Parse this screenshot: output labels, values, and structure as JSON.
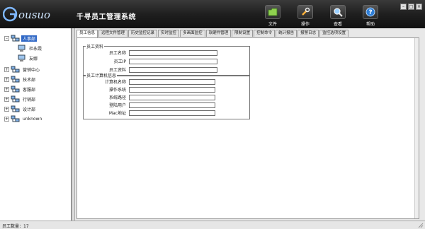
{
  "app": {
    "logo_text": "Gousuo",
    "title": "千寻员工管理系统"
  },
  "toolbar": [
    {
      "label": "文件",
      "icon": "folder-icon"
    },
    {
      "label": "操作",
      "icon": "wrench-icon"
    },
    {
      "label": "查看",
      "icon": "magnifier-icon"
    },
    {
      "label": "帮助",
      "icon": "help-icon"
    }
  ],
  "window_controls": [
    "minimize",
    "maximize",
    "close"
  ],
  "sidebar": {
    "root": {
      "label": "人事部",
      "children": [
        {
          "label": "杜永霞"
        },
        {
          "label": "友娜"
        }
      ]
    },
    "groups": [
      {
        "label": "营销中心"
      },
      {
        "label": "技术部"
      },
      {
        "label": "客服部"
      },
      {
        "label": "行销部"
      },
      {
        "label": "设计部"
      },
      {
        "label": "unknown"
      }
    ]
  },
  "tabs": [
    "员工信息",
    "远程文件管理",
    "历史监控记录",
    "实时监控",
    "多画面监控",
    "软硬件管理",
    "限制设置",
    "控制命令",
    "统计报告",
    "报警日志",
    "监控选项设置"
  ],
  "employee_info": {
    "legend": "员工资料",
    "fields": [
      {
        "label": "员工名称",
        "value": ""
      },
      {
        "label": "员工IP",
        "value": ""
      },
      {
        "label": "员工资料",
        "value": ""
      }
    ]
  },
  "computer_info": {
    "legend": "员工计算机信息",
    "fields": [
      {
        "label": "计算机名称",
        "value": ""
      },
      {
        "label": "操作系统",
        "value": ""
      },
      {
        "label": "系统路径",
        "value": ""
      },
      {
        "label": "登陆用户",
        "value": ""
      },
      {
        "label": "Mac地址",
        "value": ""
      }
    ]
  },
  "status": {
    "text": "员工数量：17"
  }
}
